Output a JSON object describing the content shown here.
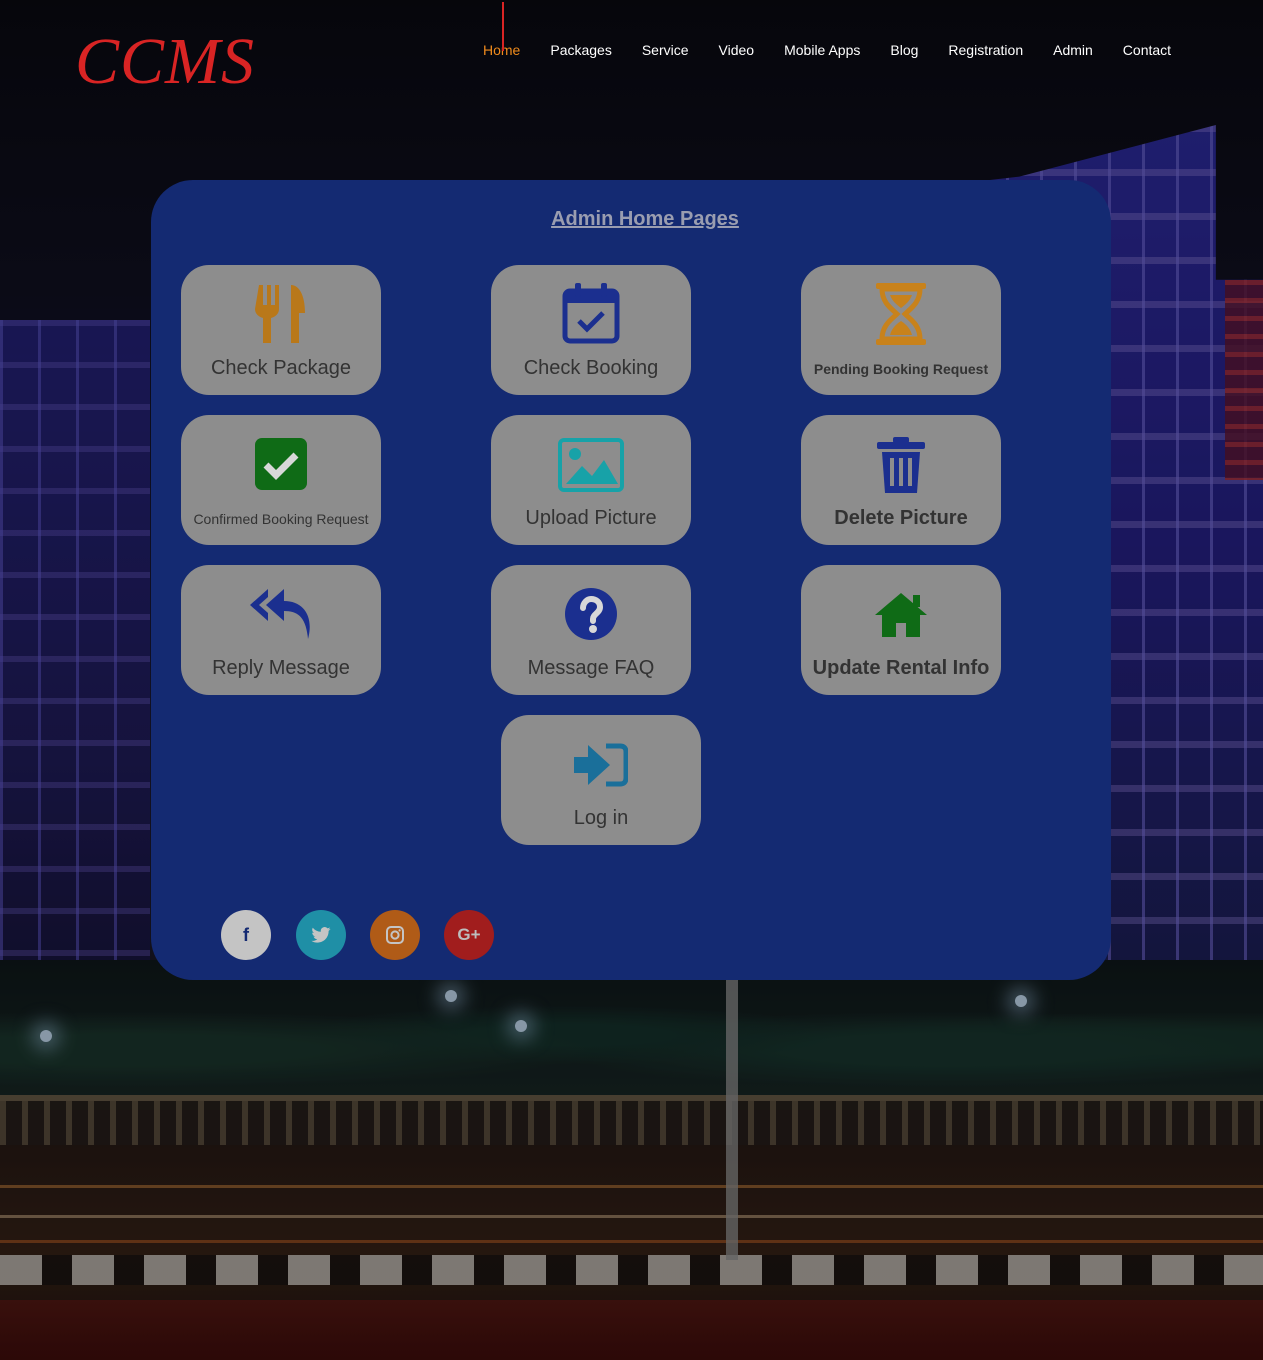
{
  "brand": {
    "logo_text": "CCMS"
  },
  "nav": {
    "items": [
      {
        "label": "Home",
        "active": true
      },
      {
        "label": "Packages"
      },
      {
        "label": "Service"
      },
      {
        "label": "Video"
      },
      {
        "label": "Mobile Apps"
      },
      {
        "label": "Blog"
      },
      {
        "label": "Registration"
      },
      {
        "label": "Admin"
      },
      {
        "label": "Contact"
      }
    ]
  },
  "panel": {
    "title": "Admin Home Pages",
    "tiles": [
      {
        "label": "Check Package",
        "icon": "fork-knife-icon",
        "icon_color": "#b9781a"
      },
      {
        "label": "Check Booking",
        "icon": "calendar-check-icon",
        "icon_color": "#1b2f8f"
      },
      {
        "label": "Pending Booking Request",
        "icon": "hourglass-icon",
        "icon_color": "#c8821b"
      },
      {
        "label": "Confirmed Booking Request",
        "icon": "checkbox-icon",
        "icon_color": "#0f6b16"
      },
      {
        "label": "Upload Picture",
        "icon": "image-icon",
        "icon_color": "#17a2a8"
      },
      {
        "label": "Delete Picture",
        "icon": "trash-icon",
        "icon_color": "#1b2f8f"
      },
      {
        "label": "Reply Message",
        "icon": "reply-all-icon",
        "icon_color": "#1b2f8f"
      },
      {
        "label": "Message FAQ",
        "icon": "question-circle-icon",
        "icon_color": "#1b2f8f"
      },
      {
        "label": "Update Rental Info",
        "icon": "home-icon",
        "icon_color": "#0f6b16"
      },
      {
        "label": "Log in",
        "icon": "sign-in-icon",
        "icon_color": "#1a6f9a"
      }
    ],
    "social": [
      {
        "name": "facebook",
        "glyph": "f",
        "color": "#c4c4c4"
      },
      {
        "name": "twitter",
        "glyph": "🐦",
        "color": "#1f8fa6"
      },
      {
        "name": "instagram",
        "glyph": "◎",
        "color": "#b05b17"
      },
      {
        "name": "google-plus",
        "glyph": "G+",
        "color": "#a11d1d"
      }
    ]
  },
  "colors": {
    "accent": "#f08b1c",
    "logo": "#d92424",
    "panel_bg": "#142a72",
    "tile_bg": "#8d8d8d"
  }
}
